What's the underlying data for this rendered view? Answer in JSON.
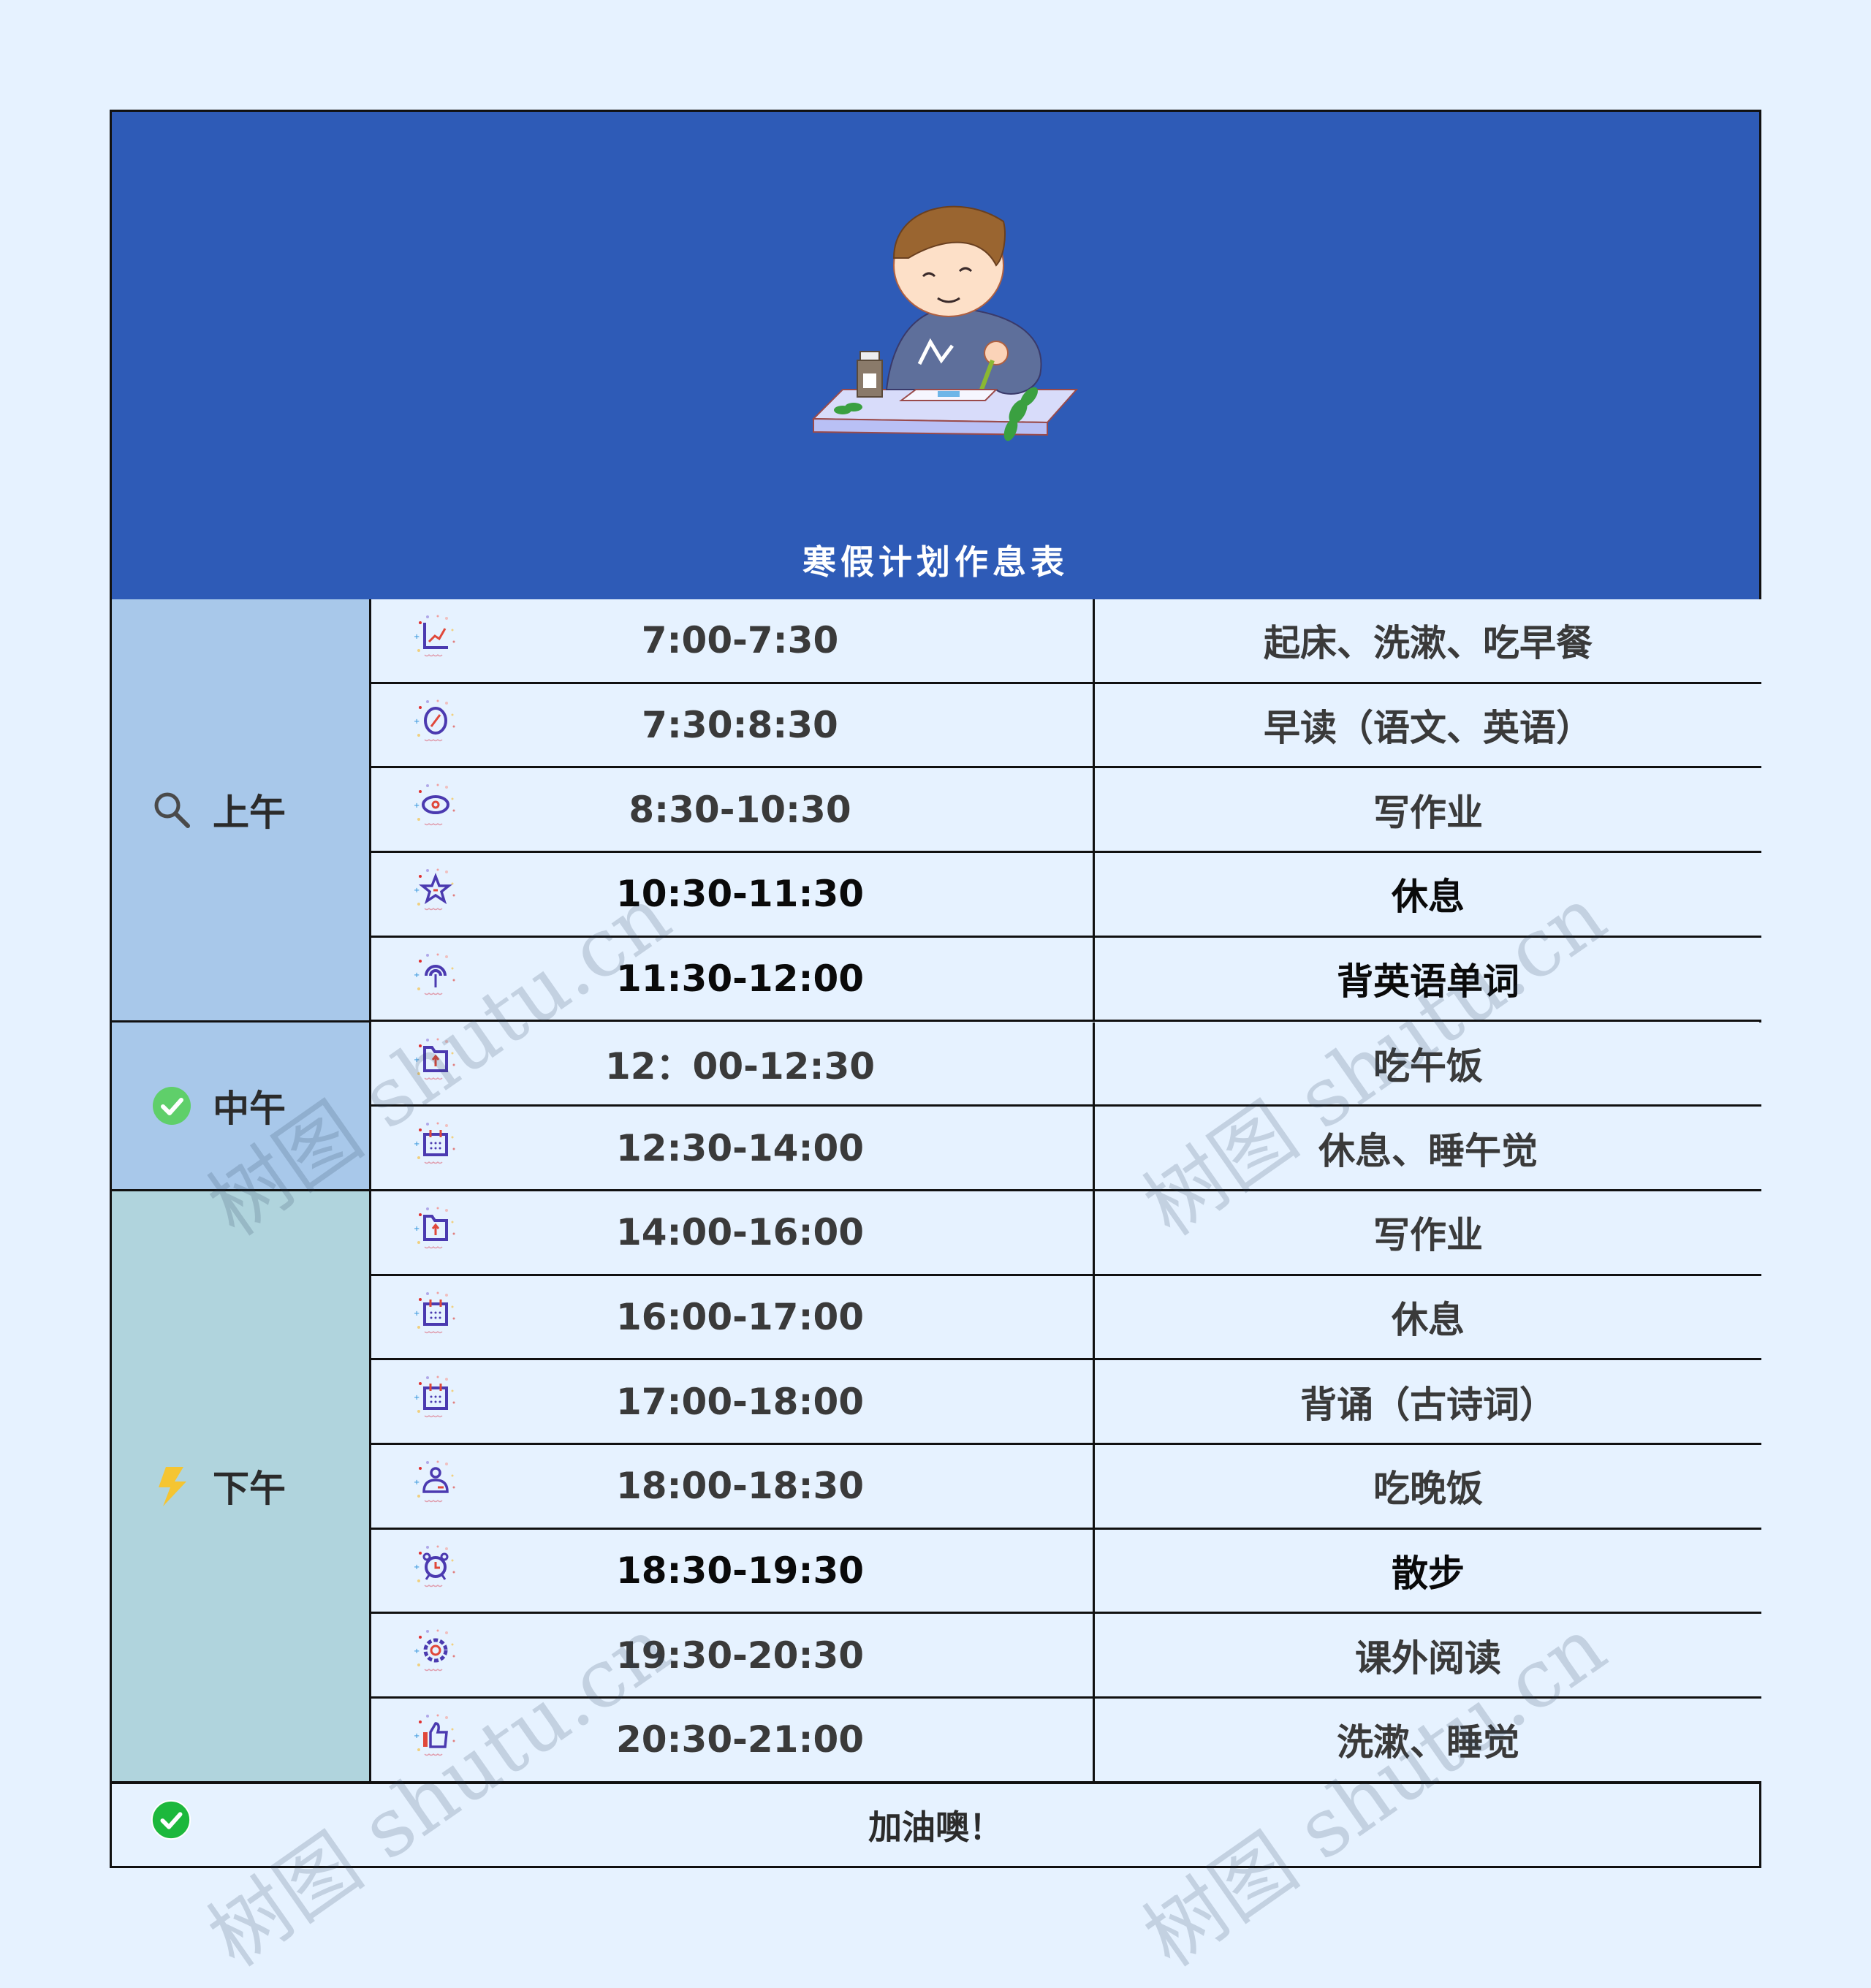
{
  "header": {
    "title": "寒假计划作息表",
    "illustration": "boy-doing-science-experiment"
  },
  "sections": [
    {
      "label": "上午",
      "icon": "search-icon",
      "rows": 5,
      "color": "#a8c8ea"
    },
    {
      "label": "中午",
      "icon": "check-circle-icon",
      "rows": 2,
      "color": "#a8c8ea"
    },
    {
      "label": "下午",
      "icon": "lightning-icon",
      "rows": 7,
      "color": "#b0d4dd"
    }
  ],
  "rows": [
    {
      "time": "7:00-7:30",
      "activity": "起床、洗漱、吃早餐",
      "icon": "chart-icon",
      "emphasis": false
    },
    {
      "time": "7:30:8:30",
      "activity": "早读（语文、英语）",
      "icon": "compass-icon",
      "emphasis": false
    },
    {
      "time": "8:30-10:30",
      "activity": "写作业",
      "icon": "eye-icon",
      "emphasis": false
    },
    {
      "time": "10:30-11:30",
      "activity": "休息",
      "icon": "star-icon",
      "emphasis": true
    },
    {
      "time": "11:30-12:00",
      "activity": "背英语单词",
      "icon": "antenna-icon",
      "emphasis": true
    },
    {
      "time": "12：00-12:30",
      "activity": "吃午饭",
      "icon": "folder-upload-icon",
      "emphasis": false
    },
    {
      "time": "12:30-14:00",
      "activity": "休息、睡午觉",
      "icon": "calendar-icon",
      "emphasis": false
    },
    {
      "time": "14:00-16:00",
      "activity": "写作业",
      "icon": "folder-upload-icon",
      "emphasis": false
    },
    {
      "time": "16:00-17:00",
      "activity": "休息",
      "icon": "calendar-icon",
      "emphasis": false
    },
    {
      "time": "17:00-18:00",
      "activity": "背诵（古诗词）",
      "icon": "calendar-icon",
      "emphasis": false
    },
    {
      "time": "18:00-18:30",
      "activity": "吃晚饭",
      "icon": "user-icon",
      "emphasis": false
    },
    {
      "time": "18:30-19:30",
      "activity": "散步",
      "icon": "alarm-clock-icon",
      "emphasis": true
    },
    {
      "time": "19:30-20:30",
      "activity": "课外阅读",
      "icon": "gear-icon",
      "emphasis": false
    },
    {
      "time": "20:30-21:00",
      "activity": "洗漱、睡觉",
      "icon": "thumbs-up-icon",
      "emphasis": false
    }
  ],
  "footer": {
    "text": "加油噢！",
    "icon": "check-circle-icon"
  },
  "watermark": "树图 shutu.cn",
  "colors": {
    "page_bg": "#e6f2ff",
    "header_bg": "#2e5bb7",
    "morning_bg": "#a8c8ea",
    "noon_bg": "#a8c8ea",
    "afternoon_bg": "#b0d4dd",
    "icon_stroke": "#4b3ab0",
    "icon_accent": "#e0483a"
  }
}
